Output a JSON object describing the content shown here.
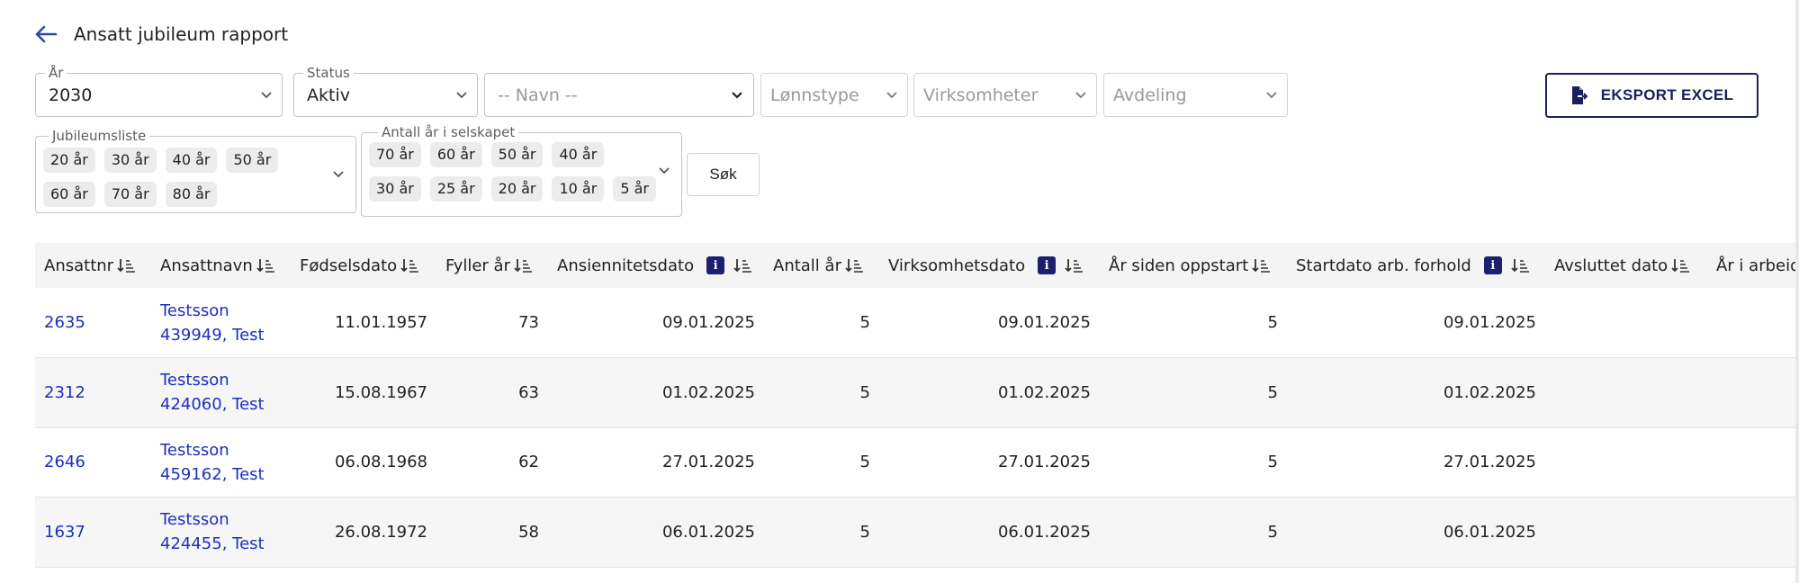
{
  "page": {
    "title": "Ansatt jubileum rapport"
  },
  "filters": {
    "year": {
      "label": "År",
      "value": "2030"
    },
    "status": {
      "label": "Status",
      "value": "Aktiv"
    },
    "name": {
      "placeholder": "-- Navn --"
    },
    "salary_type": {
      "placeholder": "Lønnstype"
    },
    "companies": {
      "placeholder": "Virksomheter"
    },
    "department": {
      "placeholder": "Avdeling"
    },
    "jubilee_list": {
      "label": "Jubileumsliste",
      "chips": [
        "20 år",
        "30 år",
        "40 år",
        "50 år",
        "60 år",
        "70 år",
        "80 år"
      ]
    },
    "years_in_company": {
      "label": "Antall år i selskapet",
      "chips": [
        "70 år",
        "60 år",
        "50 år",
        "40 år",
        "30 år",
        "25 år",
        "20 år",
        "10 år",
        "5 år"
      ]
    }
  },
  "buttons": {
    "search": "Søk",
    "export": "EKSPORT EXCEL"
  },
  "table": {
    "columns": [
      {
        "label": "Ansattnr",
        "info": false
      },
      {
        "label": "Ansattnavn",
        "info": false
      },
      {
        "label": "Fødselsdato",
        "info": false
      },
      {
        "label": "Fyller år",
        "info": false
      },
      {
        "label": "Ansiennitetsdato",
        "info": true
      },
      {
        "label": "Antall år",
        "info": false
      },
      {
        "label": "Virksomhetsdato",
        "info": true
      },
      {
        "label": "År siden oppstart",
        "info": false
      },
      {
        "label": "Startdato arb. forhold",
        "info": true
      },
      {
        "label": "Avsluttet dato",
        "info": false
      },
      {
        "label": "År i arbeid",
        "info": false
      }
    ],
    "rows": [
      {
        "id": "2635",
        "name": "Testsson 439949, Test",
        "birth": "11.01.1957",
        "turns": "73",
        "seniority": "09.01.2025",
        "years": "5",
        "company_date": "09.01.2025",
        "since_start": "5",
        "start": "09.01.2025",
        "ended": ""
      },
      {
        "id": "2312",
        "name": "Testsson 424060, Test",
        "birth": "15.08.1967",
        "turns": "63",
        "seniority": "01.02.2025",
        "years": "5",
        "company_date": "01.02.2025",
        "since_start": "5",
        "start": "01.02.2025",
        "ended": ""
      },
      {
        "id": "2646",
        "name": "Testsson 459162, Test",
        "birth": "06.08.1968",
        "turns": "62",
        "seniority": "27.01.2025",
        "years": "5",
        "company_date": "27.01.2025",
        "since_start": "5",
        "start": "27.01.2025",
        "ended": ""
      },
      {
        "id": "1637",
        "name": "Testsson 424455, Test",
        "birth": "26.08.1972",
        "turns": "58",
        "seniority": "06.01.2025",
        "years": "5",
        "company_date": "06.01.2025",
        "since_start": "5",
        "start": "06.01.2025",
        "ended": ""
      }
    ]
  }
}
